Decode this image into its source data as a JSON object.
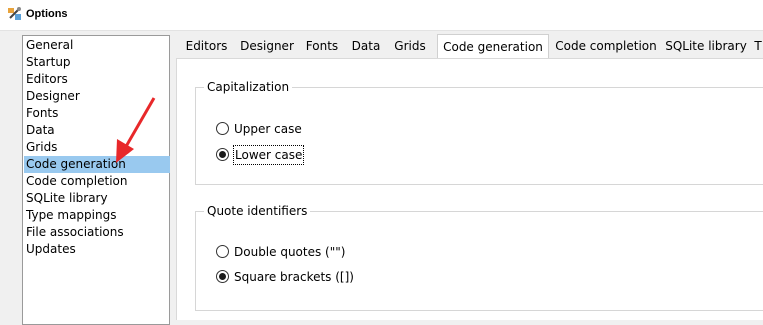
{
  "window": {
    "title": "Options"
  },
  "sidebar": {
    "items": [
      {
        "label": "General"
      },
      {
        "label": "Startup"
      },
      {
        "label": "Editors"
      },
      {
        "label": "Designer"
      },
      {
        "label": "Fonts"
      },
      {
        "label": "Data"
      },
      {
        "label": "Grids"
      },
      {
        "label": "Code generation",
        "selected": true
      },
      {
        "label": "Code completion"
      },
      {
        "label": "SQLite library"
      },
      {
        "label": "Type mappings"
      },
      {
        "label": "File associations"
      },
      {
        "label": "Updates"
      }
    ]
  },
  "tabs": [
    {
      "label": "Editors"
    },
    {
      "label": "Designer"
    },
    {
      "label": "Fonts"
    },
    {
      "label": "Data"
    },
    {
      "label": "Grids"
    },
    {
      "label": "Code generation",
      "active": true
    },
    {
      "label": "Code completion"
    },
    {
      "label": "SQLite library"
    },
    {
      "label": "T"
    }
  ],
  "capitalization": {
    "legend": "Capitalization",
    "options": [
      {
        "label": "Upper case",
        "checked": false
      },
      {
        "label": "Lower case",
        "checked": true
      }
    ]
  },
  "quote_identifiers": {
    "legend": "Quote identifiers",
    "options": [
      {
        "label": "Double quotes (\"\")",
        "checked": false
      },
      {
        "label": "Square brackets ([])",
        "checked": true
      }
    ]
  },
  "colors": {
    "selection": "#99c9ef",
    "annotation_arrow": "#e8282a"
  }
}
